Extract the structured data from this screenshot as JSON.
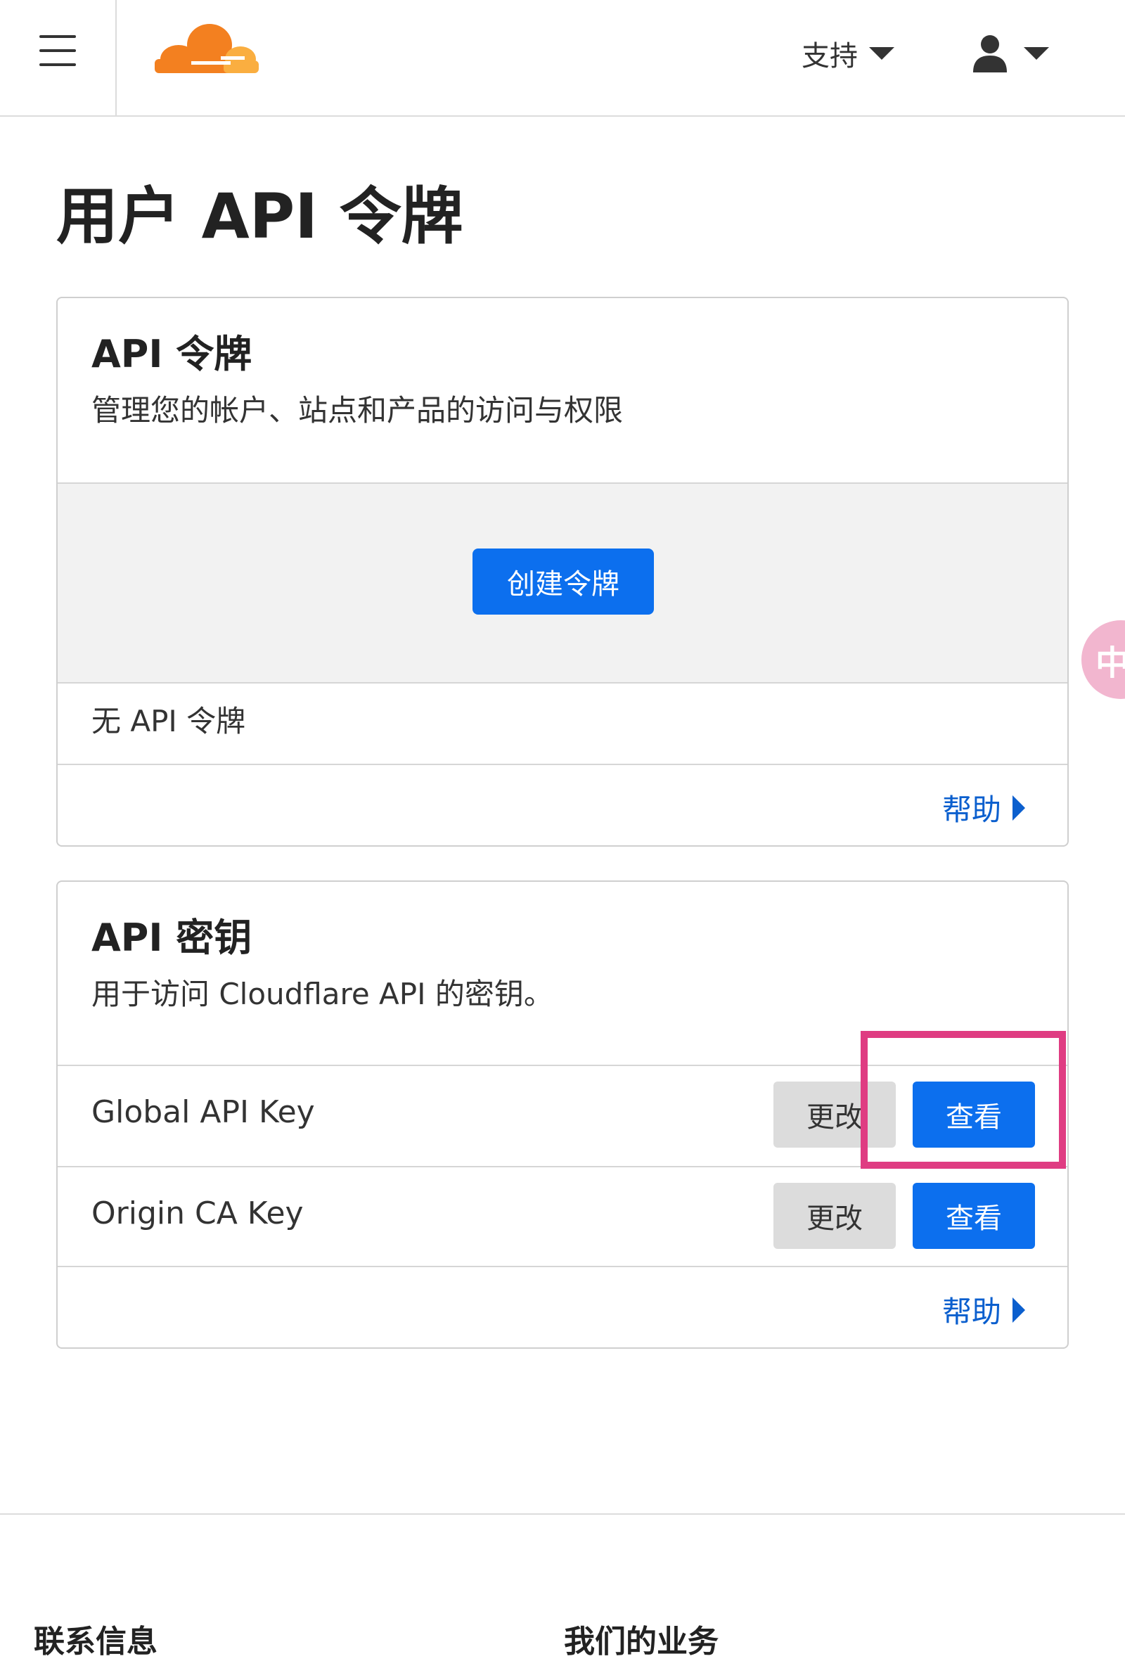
{
  "header": {
    "support_label": "支持"
  },
  "page": {
    "title": "用户 API 令牌"
  },
  "tokens_card": {
    "title": "API 令牌",
    "description": "管理您的帐户、站点和产品的访问与权限",
    "create_button": "创建令牌",
    "empty_text": "无 API 令牌",
    "help_link": "帮助"
  },
  "keys_card": {
    "title": "API 密钥",
    "description": "用于访问 Cloudflare API 的密钥。",
    "rows": [
      {
        "label": "Global API Key",
        "change_button": "更改",
        "view_button": "查看"
      },
      {
        "label": "Origin CA Key",
        "change_button": "更改",
        "view_button": "查看"
      }
    ],
    "help_link": "帮助"
  },
  "side_widget": {
    "glyph": "中"
  },
  "footer": {
    "col1_heading": "联系信息",
    "col2_heading": "我们的业务"
  },
  "colors": {
    "brand_orange": "#f38020",
    "primary_blue": "#0c6fee",
    "link_blue": "#0b5fce",
    "highlight_pink": "#df3c82"
  },
  "icons": {
    "menu": "hamburger-icon",
    "logo": "cloudflare-logo",
    "support_caret": "caret-down-icon",
    "user": "user-icon",
    "help_arrow": "play-right-icon"
  }
}
